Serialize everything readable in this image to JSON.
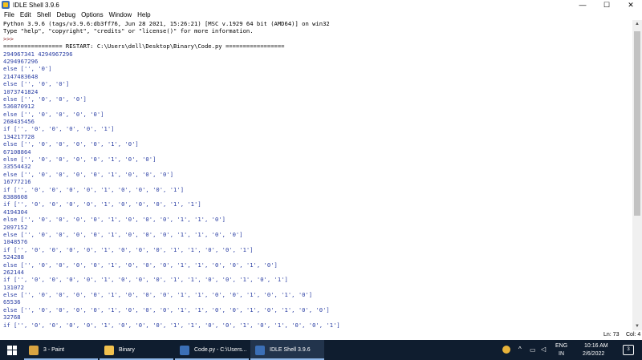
{
  "window": {
    "title": "IDLE Shell 3.9.6",
    "controls": {
      "minimize": "—",
      "maximize": "☐",
      "close": "✕"
    }
  },
  "menu": [
    "File",
    "Edit",
    "Shell",
    "Debug",
    "Options",
    "Window",
    "Help"
  ],
  "shell": {
    "lines": [
      {
        "type": "normal",
        "text": "Python 3.9.6 (tags/v3.9.6:db3ff76, Jun 28 2021, 15:26:21) [MSC v.1929 64 bit (AMD64)] on win32"
      },
      {
        "type": "normal",
        "text": "Type \"help\", \"copyright\", \"credits\" or \"license()\" for more information."
      },
      {
        "type": "prompt",
        "text": ">>>"
      },
      {
        "type": "normal",
        "text": "================= RESTART: C:\\Users\\dell\\Desktop\\Binary\\Code.py ================="
      },
      {
        "type": "output",
        "text": "294967341 4294967296"
      },
      {
        "type": "output",
        "text": "4294967296"
      },
      {
        "type": "output",
        "text": "else ['', '0']"
      },
      {
        "type": "output",
        "text": "2147483648"
      },
      {
        "type": "output",
        "text": "else ['', '0', '0']"
      },
      {
        "type": "output",
        "text": "1073741824"
      },
      {
        "type": "output",
        "text": "else ['', '0', '0', '0']"
      },
      {
        "type": "output",
        "text": "536870912"
      },
      {
        "type": "output",
        "text": "else ['', '0', '0', '0', '0']"
      },
      {
        "type": "output",
        "text": "268435456"
      },
      {
        "type": "output",
        "text": "if ['', '0', '0', '0', '0', '1']"
      },
      {
        "type": "output",
        "text": "134217728"
      },
      {
        "type": "output",
        "text": "else ['', '0', '0', '0', '0', '1', '0']"
      },
      {
        "type": "output",
        "text": "67108864"
      },
      {
        "type": "output",
        "text": "else ['', '0', '0', '0', '0', '1', '0', '0']"
      },
      {
        "type": "output",
        "text": "33554432"
      },
      {
        "type": "output",
        "text": "else ['', '0', '0', '0', '0', '1', '0', '0', '0']"
      },
      {
        "type": "output",
        "text": "16777216"
      },
      {
        "type": "output",
        "text": "if ['', '0', '0', '0', '0', '1', '0', '0', '0', '1']"
      },
      {
        "type": "output",
        "text": "8388608"
      },
      {
        "type": "output",
        "text": "if ['', '0', '0', '0', '0', '1', '0', '0', '0', '1', '1']"
      },
      {
        "type": "output",
        "text": "4194304"
      },
      {
        "type": "output",
        "text": "else ['', '0', '0', '0', '0', '1', '0', '0', '0', '1', '1', '0']"
      },
      {
        "type": "output",
        "text": "2097152"
      },
      {
        "type": "output",
        "text": "else ['', '0', '0', '0', '0', '1', '0', '0', '0', '1', '1', '0', '0']"
      },
      {
        "type": "output",
        "text": "1048576"
      },
      {
        "type": "output",
        "text": "if ['', '0', '0', '0', '0', '1', '0', '0', '0', '1', '1', '0', '0', '1']"
      },
      {
        "type": "output",
        "text": "524288"
      },
      {
        "type": "output",
        "text": "else ['', '0', '0', '0', '0', '1', '0', '0', '0', '1', '1', '0', '0', '1', '0']"
      },
      {
        "type": "output",
        "text": "262144"
      },
      {
        "type": "output",
        "text": "if ['', '0', '0', '0', '0', '1', '0', '0', '0', '1', '1', '0', '0', '1', '0', '1']"
      },
      {
        "type": "output",
        "text": "131072"
      },
      {
        "type": "output",
        "text": "else ['', '0', '0', '0', '0', '1', '0', '0', '0', '1', '1', '0', '0', '1', '0', '1', '0']"
      },
      {
        "type": "output",
        "text": "65536"
      },
      {
        "type": "output",
        "text": "else ['', '0', '0', '0', '0', '1', '0', '0', '0', '1', '1', '0', '0', '1', '0', '1', '0', '0']"
      },
      {
        "type": "output",
        "text": "32768"
      },
      {
        "type": "output",
        "text": "if ['', '0', '0', '0', '0', '1', '0', '0', '0', '1', '1', '0', '0', '1', '0', '1', '0', '0', '1']"
      }
    ]
  },
  "status": {
    "line": "Ln: 73",
    "col": "Col: 4"
  },
  "taskbar": {
    "items": [
      {
        "label": "3 - Paint",
        "icon": "paint-icon",
        "color": "#d9a441"
      },
      {
        "label": "Binary",
        "icon": "folder-icon",
        "color": "#f2c14e"
      },
      {
        "label": "Code.py - C:\\Users...",
        "icon": "python-file-icon",
        "color": "#3b6fb6"
      },
      {
        "label": "IDLE Shell 3.9.6",
        "icon": "idle-icon",
        "color": "#3b6fb6",
        "active": true
      }
    ],
    "tray": {
      "lang1": "ENG",
      "lang2": "IN",
      "time": "10:16 AM",
      "date": "2/6/2022",
      "notifications": "3"
    }
  },
  "colors": {
    "output": "#2a3ea3",
    "prompt": "#8b2323",
    "taskbar": "#0f1d2f"
  }
}
